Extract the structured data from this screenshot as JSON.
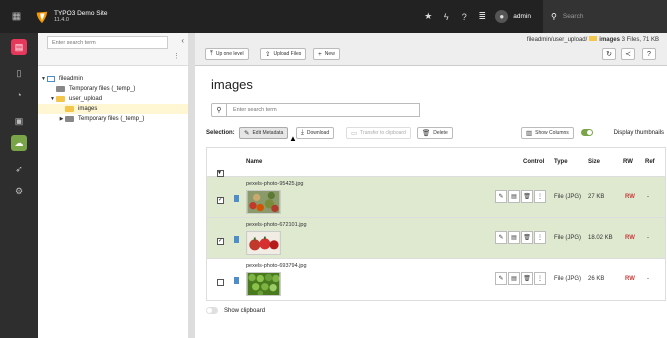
{
  "topbar": {
    "site_name": "TYPO3 Demo Site",
    "version": "11.4.0",
    "username": "admin",
    "search_placeholder": "Search"
  },
  "tree": {
    "search_placeholder": "Enter search term",
    "nodes": [
      {
        "label": "fileadmin"
      },
      {
        "label": "Temporary files (_temp_)"
      },
      {
        "label": "user_upload"
      },
      {
        "label": "images"
      },
      {
        "label": "Temporary files (_temp_)"
      }
    ]
  },
  "toolbar": {
    "up_one_level": "Up one level",
    "upload_files": "Upload Files",
    "new": "New"
  },
  "path": {
    "prefix": "fileadmin/user_upload/",
    "current": "images",
    "summary": "3 Files, 71 KB"
  },
  "main": {
    "title": "images",
    "search_placeholder": "Enter search term"
  },
  "selection": {
    "label": "Selection:",
    "edit_metadata": "Edit Metadata",
    "download": "Download",
    "transfer": "Transfer to clipboard",
    "delete": "Delete",
    "show_columns": "Show Columns",
    "display_thumbnails": "Display thumbnails"
  },
  "table": {
    "columns": {
      "name": "Name",
      "control": "Control",
      "type": "Type",
      "size": "Size",
      "rw": "RW",
      "ref": "Ref"
    },
    "rows": [
      {
        "name": "pexels-photo-95425.jpg",
        "type": "File (JPG)",
        "size": "27 KB",
        "rw": "RW",
        "ref": "-",
        "selected": true
      },
      {
        "name": "pexels-photo-672101.jpg",
        "type": "File (JPG)",
        "size": "18.02 KB",
        "rw": "RW",
        "ref": "-",
        "selected": true
      },
      {
        "name": "pexels-photo-693794.jpg",
        "type": "File (JPG)",
        "size": "26 KB",
        "rw": "RW",
        "ref": "-",
        "selected": false
      }
    ]
  },
  "clipboard": {
    "label": "Show clipboard"
  },
  "colors": {
    "accent_pink": "#e5385b",
    "accent_green": "#79a548",
    "selected_row": "#dfe9d0",
    "rw_red": "#c83c3c"
  }
}
